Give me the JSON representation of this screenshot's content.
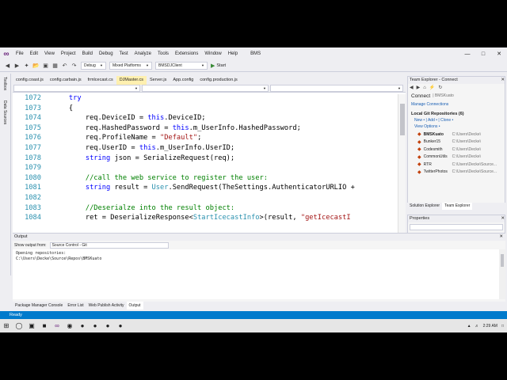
{
  "window": {
    "menu": [
      "File",
      "Edit",
      "View",
      "Project",
      "Build",
      "Debug",
      "Test",
      "Analyze",
      "Tools",
      "Extensions",
      "Window",
      "Help"
    ],
    "solution_name": "BMS"
  },
  "toolbar": {
    "config": "Debug",
    "platform": "Mixed Platforms",
    "startup_project": "BMSDJClient",
    "start_label": "Start"
  },
  "left_tabs": [
    "Toolbox",
    "Data Sources"
  ],
  "doc_tabs": [
    "config.coast.js",
    "config.carbain.js",
    "frmlcecast.cs",
    "DJMaster.cs",
    "Server.js",
    "App.config",
    "config.production.js"
  ],
  "active_doc_tab": "DJMaster.cs",
  "code_lines": [
    {
      "no": "1072",
      "indent": 4,
      "tokens": [
        {
          "t": "try",
          "c": "kw"
        }
      ]
    },
    {
      "no": "1073",
      "indent": 4,
      "tokens": [
        {
          "t": "{",
          "c": ""
        }
      ]
    },
    {
      "no": "1074",
      "indent": 8,
      "tokens": [
        {
          "t": "req.DeviceID = ",
          "c": ""
        },
        {
          "t": "this",
          "c": "kw"
        },
        {
          "t": ".DeviceID;",
          "c": ""
        }
      ]
    },
    {
      "no": "1075",
      "indent": 8,
      "tokens": [
        {
          "t": "req.HashedPassword = ",
          "c": ""
        },
        {
          "t": "this",
          "c": "kw"
        },
        {
          "t": ".m_UserInfo.HashedPassword;",
          "c": ""
        }
      ]
    },
    {
      "no": "1076",
      "indent": 8,
      "tokens": [
        {
          "t": "req.ProfileName = ",
          "c": ""
        },
        {
          "t": "\"Default\"",
          "c": "str"
        },
        {
          "t": ";",
          "c": ""
        }
      ]
    },
    {
      "no": "1077",
      "indent": 8,
      "tokens": [
        {
          "t": "req.UserID = ",
          "c": ""
        },
        {
          "t": "this",
          "c": "kw"
        },
        {
          "t": ".m_UserInfo.UserID;",
          "c": ""
        }
      ]
    },
    {
      "no": "1078",
      "indent": 8,
      "tokens": [
        {
          "t": "string",
          "c": "kw"
        },
        {
          "t": " json = SerializeRequest(req);",
          "c": ""
        }
      ]
    },
    {
      "no": "1079",
      "indent": 0,
      "tokens": []
    },
    {
      "no": "1080",
      "indent": 8,
      "tokens": [
        {
          "t": "//call the web service to register the user:",
          "c": "cmt"
        }
      ]
    },
    {
      "no": "1081",
      "indent": 8,
      "tokens": [
        {
          "t": "string",
          "c": "kw"
        },
        {
          "t": " result = ",
          "c": ""
        },
        {
          "t": "User",
          "c": "type"
        },
        {
          "t": ".SendRequest(TheSettings.AuthenticatorURLIO +",
          "c": ""
        }
      ]
    },
    {
      "no": "1082",
      "indent": 0,
      "tokens": []
    },
    {
      "no": "1083",
      "indent": 8,
      "tokens": [
        {
          "t": "//Deserialze into the result object:",
          "c": "cmt"
        }
      ]
    },
    {
      "no": "1084",
      "indent": 8,
      "tokens": [
        {
          "t": "ret = DeserializeResponse<",
          "c": ""
        },
        {
          "t": "StartIcecastInfo",
          "c": "type"
        },
        {
          "t": ">(result, ",
          "c": ""
        },
        {
          "t": "\"getIcecastI",
          "c": "str"
        }
      ]
    }
  ],
  "editor_status": {
    "zoom": "100 %",
    "issues": "No issues found",
    "ln": "Ln: 1084",
    "ch": "Ch: 7",
    "spc": "SPC",
    "crlf": "CRLF"
  },
  "team_explorer": {
    "title": "Team Explorer - Connect",
    "connect_label": "Connect",
    "connect_sub": "| BMSKuato",
    "manage_connections": "Manage Connections",
    "local_repos_header": "Local Git Repositories (6)",
    "actions": "New • | Add • | Clone •",
    "view_options": "View Options •",
    "repos": [
      {
        "name": "BMSKuato",
        "path": "C:\\Users\\Decke\\"
      },
      {
        "name": "Bunker15",
        "path": "C:\\Users\\Decke\\"
      },
      {
        "name": "Codesmith",
        "path": "C:\\Users\\Decke\\"
      },
      {
        "name": "CommonUtils",
        "path": "C:\\Users\\Decke\\"
      },
      {
        "name": "RTR",
        "path": "C:\\Users\\Decke\\Source..."
      },
      {
        "name": "TwitterPhotos",
        "path": "C:\\Users\\Decke\\Source..."
      }
    ],
    "tabs": [
      "Solution Explorer",
      "Team Explorer"
    ],
    "active_tab": "Team Explorer"
  },
  "properties": {
    "title": "Properties"
  },
  "output": {
    "title": "Output",
    "show_from_label": "Show output from:",
    "source": "Source Control - Git",
    "lines": [
      "Opening repositories:",
      "C:\\Users\\Decke\\Source\\Repos\\BMSKuato"
    ]
  },
  "bottom_tabs": [
    "Package Manager Console",
    "Error List",
    "Web Publish Activity",
    "Output"
  ],
  "active_bottom_tab": "Output",
  "statusbar": {
    "text": "Ready"
  },
  "taskbar": {
    "time": "2:29 AM"
  }
}
